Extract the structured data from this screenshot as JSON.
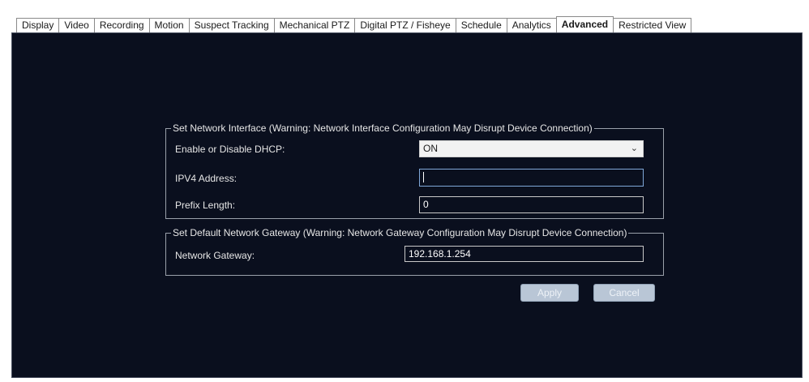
{
  "tabs": [
    {
      "label": "Display"
    },
    {
      "label": "Video"
    },
    {
      "label": "Recording"
    },
    {
      "label": "Motion"
    },
    {
      "label": "Suspect Tracking"
    },
    {
      "label": "Mechanical PTZ"
    },
    {
      "label": "Digital PTZ / Fisheye"
    },
    {
      "label": "Schedule"
    },
    {
      "label": "Analytics"
    },
    {
      "label": "Advanced"
    },
    {
      "label": "Restricted View"
    }
  ],
  "network_interface": {
    "legend": "Set Network Interface (Warning: Network Interface Configuration May Disrupt Device Connection)",
    "dhcp_label": "Enable or Disable DHCP:",
    "dhcp_value": "ON",
    "ipv4_label": "IPV4 Address:",
    "ipv4_value": "",
    "prefix_label": "Prefix Length:",
    "prefix_value": "0"
  },
  "gateway": {
    "legend": "Set Default Network Gateway (Warning: Network Gateway Configuration May Disrupt Device Connection)",
    "label": "Network Gateway:",
    "value": "192.168.1.254"
  },
  "buttons": {
    "apply": "Apply",
    "cancel": "Cancel"
  },
  "active_tab": "Advanced"
}
